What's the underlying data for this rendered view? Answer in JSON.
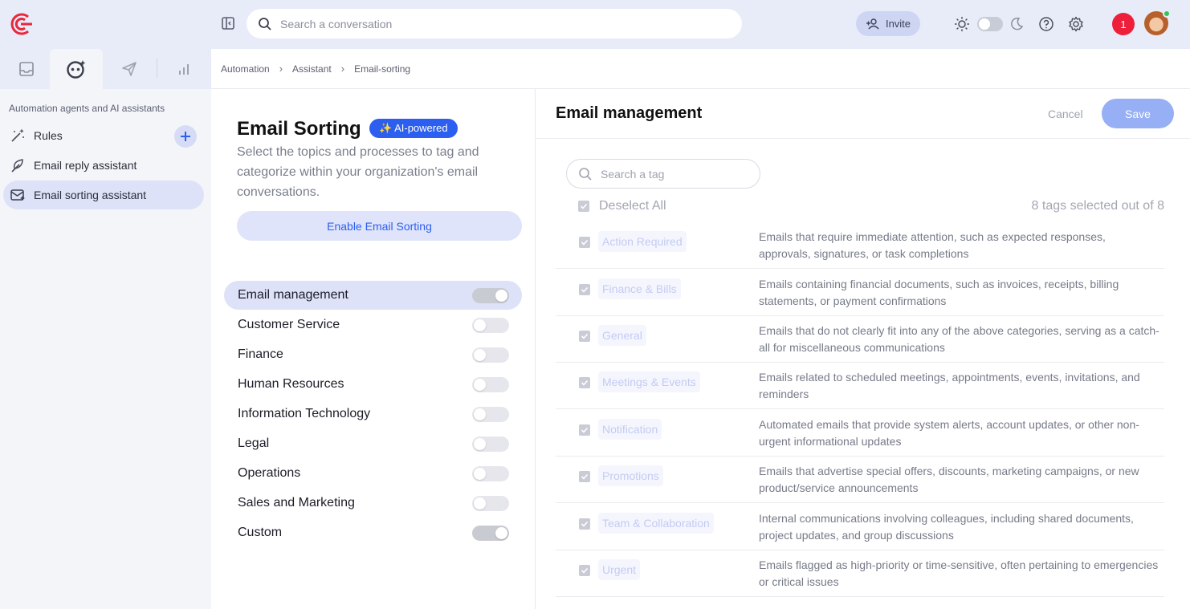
{
  "topbar": {
    "search_placeholder": "Search a conversation",
    "invite_label": "Invite",
    "notification_count": "1",
    "accent_color": "#ee1f3a"
  },
  "nav": {
    "caption": "Automation agents and AI assistants",
    "items": [
      {
        "label": "Rules",
        "icon": "magic-wand-icon"
      },
      {
        "label": "Email reply assistant",
        "icon": "feather-icon"
      },
      {
        "label": "Email sorting assistant",
        "icon": "mail-sort-icon",
        "active": true
      }
    ]
  },
  "breadcrumb": [
    "Automation",
    "Assistant",
    "Email-sorting"
  ],
  "sorting": {
    "title": "Email Sorting",
    "badge": "✨ AI-powered",
    "description": "Select the topics and processes to tag and categorize within your organization's email conversations.",
    "enable_label": "Enable Email Sorting",
    "categories": [
      {
        "label": "Email management",
        "on": true,
        "active": true
      },
      {
        "label": "Customer Service",
        "on": false
      },
      {
        "label": "Finance",
        "on": false
      },
      {
        "label": "Human Resources",
        "on": false
      },
      {
        "label": "Information Technology",
        "on": false
      },
      {
        "label": "Legal",
        "on": false
      },
      {
        "label": "Operations",
        "on": false
      },
      {
        "label": "Sales and Marketing",
        "on": false
      },
      {
        "label": "Custom",
        "on": true
      }
    ]
  },
  "panel": {
    "title": "Email management",
    "cancel_label": "Cancel",
    "save_label": "Save",
    "tag_search_placeholder": "Search a tag",
    "deselect_label": "Deselect All",
    "selected_count": "8 tags selected out of 8",
    "tags": [
      {
        "name": "Action Required",
        "desc": "Emails that require immediate attention, such as expected responses, approvals, signatures, or task completions"
      },
      {
        "name": "Finance & Bills",
        "desc": "Emails containing financial documents, such as invoices, receipts, billing statements, or payment confirmations"
      },
      {
        "name": "General",
        "desc": "Emails that do not clearly fit into any of the above categories, serving as a catch-all for miscellaneous communications"
      },
      {
        "name": "Meetings & Events",
        "desc": "Emails related to scheduled meetings, appointments, events, invitations, and reminders"
      },
      {
        "name": "Notification",
        "desc": "Automated emails that provide system alerts, account updates, or other non-urgent informational updates"
      },
      {
        "name": "Promotions",
        "desc": "Emails that advertise special offers, discounts, marketing campaigns, or new product/service announcements"
      },
      {
        "name": "Team & Collaboration",
        "desc": "Internal communications involving colleagues, including shared documents, project updates, and group discussions"
      },
      {
        "name": "Urgent",
        "desc": "Emails flagged as high-priority or time-sensitive, often pertaining to emergencies or critical issues"
      }
    ]
  }
}
